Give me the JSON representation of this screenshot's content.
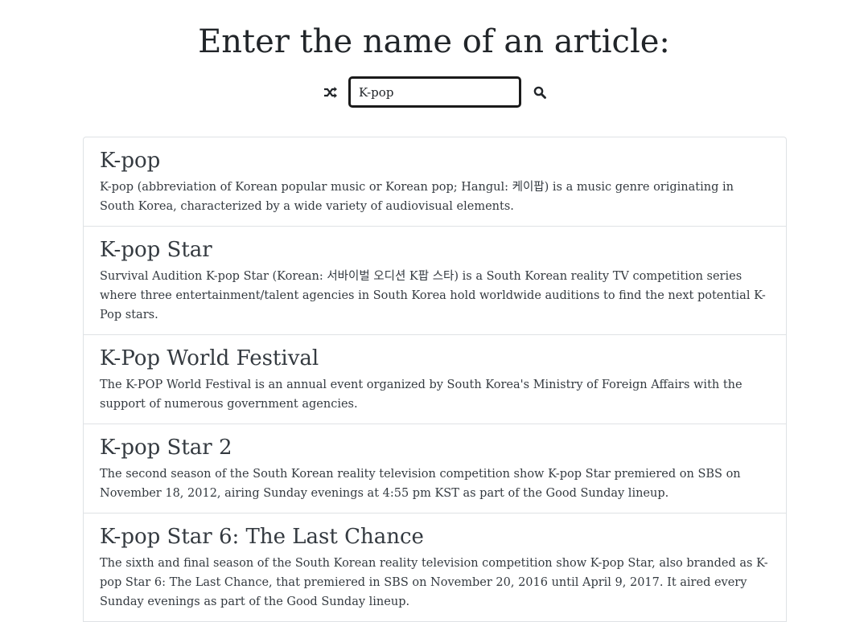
{
  "heading": "Enter the name of an article:",
  "search": {
    "value": "K-pop",
    "random_icon": "shuffle-icon",
    "search_icon": "search-icon"
  },
  "results": [
    {
      "title": "K-pop",
      "snippet": "K-pop (abbreviation of Korean popular music or Korean pop; Hangul: 케이팝) is a music genre originating in South Korea, characterized by a wide variety of audiovisual elements."
    },
    {
      "title": "K-pop Star",
      "snippet": "Survival Audition K-pop Star (Korean: 서바이벌 오디션 K팝 스타) is a South Korean reality TV competition series where three entertainment/talent agencies in South Korea hold worldwide auditions to find the next potential K-Pop stars."
    },
    {
      "title": "K-Pop World Festival",
      "snippet": "The K-POP World Festival is an annual event organized by South Korea's Ministry of Foreign Affairs with the support of numerous government agencies."
    },
    {
      "title": "K-pop Star 2",
      "snippet": "The second season of the South Korean reality television competition show K-pop Star premiered on SBS on November 18, 2012, airing Sunday evenings at 4:55 pm KST as part of the Good Sunday lineup."
    },
    {
      "title": "K-pop Star 6: The Last Chance",
      "snippet": "The sixth and final season of the South Korean reality television competition show K-pop Star, also branded as K-pop Star 6: The Last Chance, that premiered in SBS on November 20, 2016 until April 9, 2017. It aired every Sunday evenings as part of the Good Sunday lineup."
    }
  ]
}
